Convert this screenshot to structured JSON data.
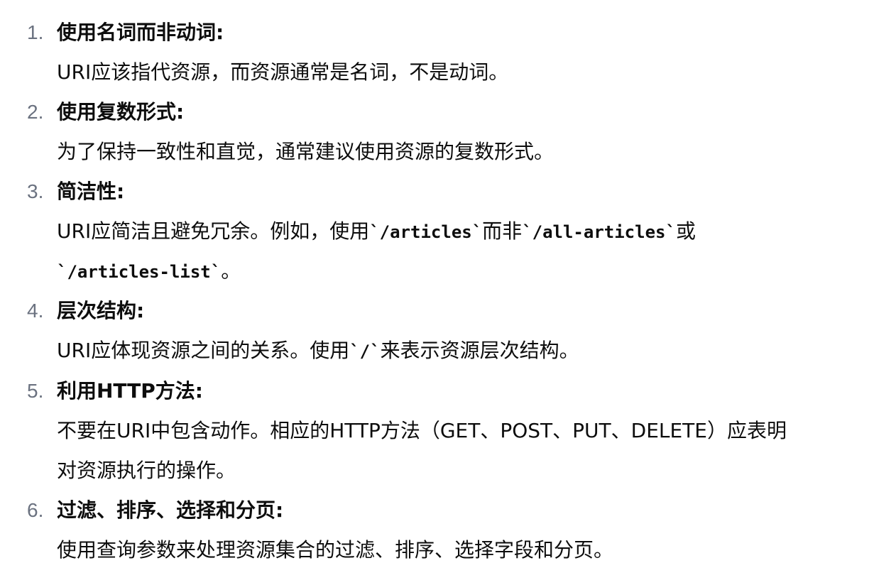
{
  "items": [
    {
      "number": "1.",
      "title": "使用名词而非动词:",
      "desc": "URI应该指代资源，而资源通常是名词，不是动词。"
    },
    {
      "number": "2.",
      "title": "使用复数形式:",
      "desc": "为了保持一致性和直觉，通常建议使用资源的复数形式。"
    },
    {
      "number": "3.",
      "title": "简洁性:",
      "desc_line1_a": "URI应简洁且避免冗余。例如，使用",
      "desc_code1": "`/articles`",
      "desc_line1_b": "而非",
      "desc_code2": "`/all-articles`",
      "desc_line1_c": "或",
      "desc_code3": "`/articles-list`",
      "desc_line2_end": "。"
    },
    {
      "number": "4.",
      "title": "层次结构:",
      "desc_a": "URI应体现资源之间的关系。使用",
      "desc_code": "`/`",
      "desc_b": "来表示资源层次结构。"
    },
    {
      "number": "5.",
      "title": "利用HTTP方法:",
      "desc_line1": "不要在URI中包含动作。相应的HTTP方法（GET、POST、PUT、DELETE）应表明",
      "desc_line2": "对资源执行的操作。"
    },
    {
      "number": "6.",
      "title": "过滤、排序、选择和分页:",
      "desc": "使用查询参数来处理资源集合的过滤、排序、选择字段和分页。"
    }
  ]
}
